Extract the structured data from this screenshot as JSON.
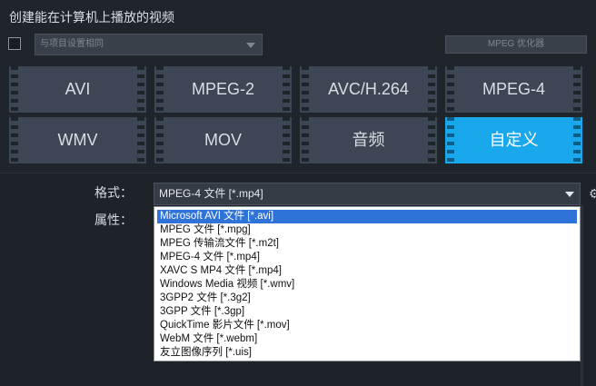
{
  "title": "创建能在计算机上播放的视频",
  "profile": {
    "checkbox_checked": false,
    "select_value": "与项目设置相同",
    "optimizer_label": "MPEG 优化器"
  },
  "formats": [
    {
      "label": "AVI",
      "selected": false
    },
    {
      "label": "MPEG-2",
      "selected": false
    },
    {
      "label": "AVC/H.264",
      "selected": false
    },
    {
      "label": "MPEG-4",
      "selected": false
    },
    {
      "label": "WMV",
      "selected": false
    },
    {
      "label": "MOV",
      "selected": false
    },
    {
      "label": "音频",
      "selected": false
    },
    {
      "label": "自定义",
      "selected": true
    }
  ],
  "settings": {
    "format_label": "格式：",
    "format_value": "MPEG-4 文件 [*.mp4]",
    "properties_label": "属性："
  },
  "dropdown": {
    "items": [
      "Microsoft AVI 文件 [*.avi]",
      "MPEG 文件 [*.mpg]",
      "MPEG 传输流文件 [*.m2t]",
      "MPEG-4 文件 [*.mp4]",
      "XAVC S MP4 文件 [*.mp4]",
      "Windows Media 视频 [*.wmv]",
      "3GPP2 文件 [*.3g2]",
      "3GPP 文件 [*.3gp]",
      "QuickTime 影片文件 [*.mov]",
      "WebM 文件 [*.webm]",
      "友立图像序列 [*.uis]"
    ],
    "highlighted": "Microsoft AVI 文件 [*.avi]"
  },
  "colors": {
    "accent": "#1aa8ec",
    "tile": "#3d4654",
    "background": "#1e232a",
    "highlight": "#2f73d8"
  },
  "icons": {
    "dropdown": "chevron-down-icon",
    "settings": "gear-icon"
  }
}
